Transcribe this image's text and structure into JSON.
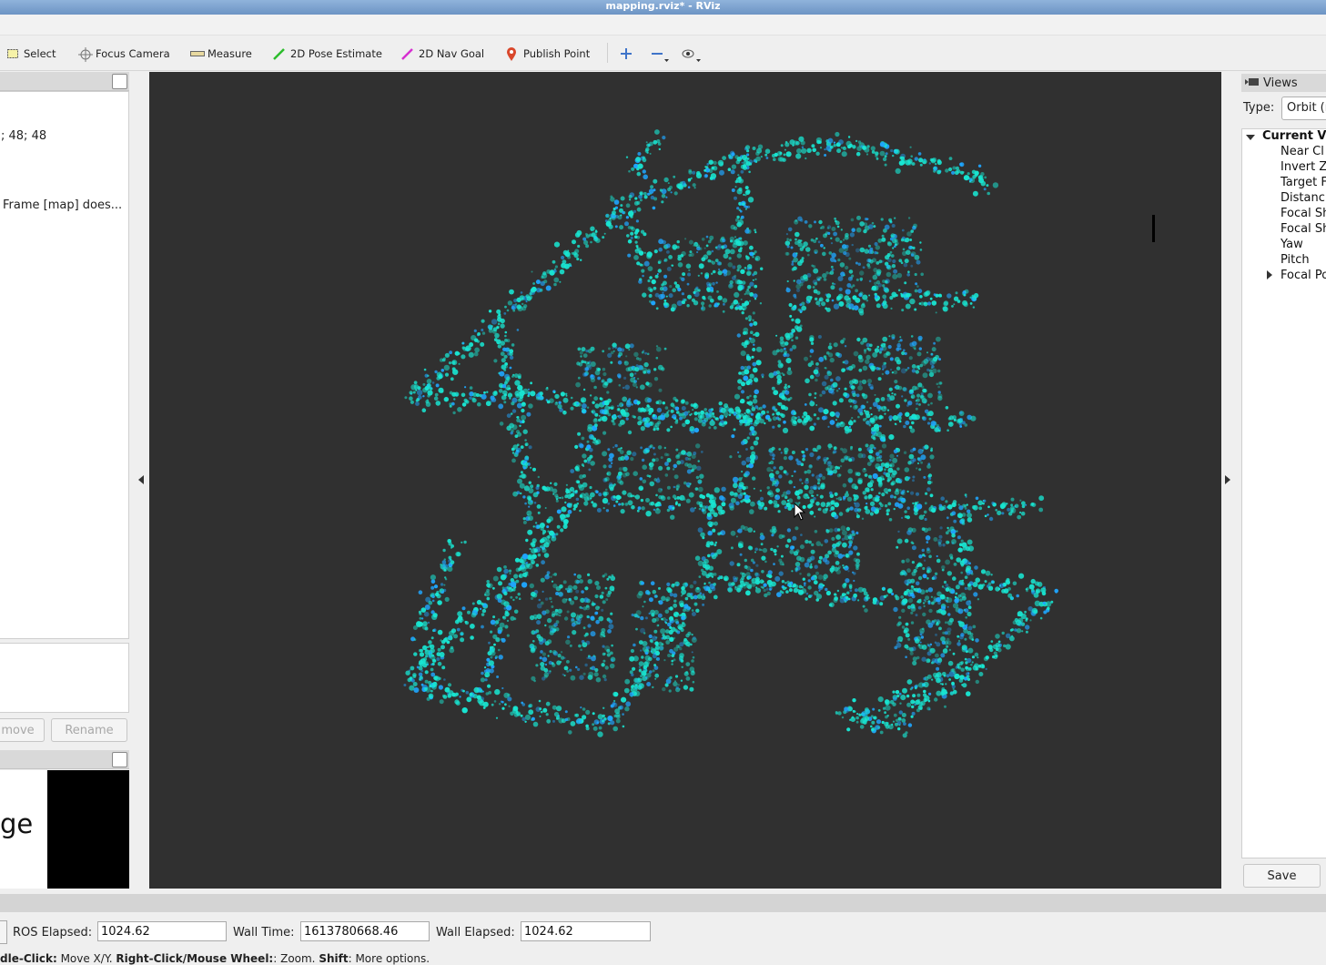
{
  "window": {
    "title": "mapping.rviz* - RViz"
  },
  "toolbar": {
    "select": "Select",
    "focus_camera": "Focus Camera",
    "measure": "Measure",
    "pose_estimate": "2D Pose Estimate",
    "nav_goal": "2D Nav Goal",
    "publish_point": "Publish Point"
  },
  "left_panel": {
    "row1": "; 48; 48",
    "row2": "Frame [map] does...",
    "remove_button": "move",
    "rename_button": "Rename",
    "image_text": "ge"
  },
  "views_panel": {
    "title": "Views",
    "type_label": "Type:",
    "type_value": "Orbit (r",
    "tree": {
      "root": "Current V",
      "items": [
        "Near Cl",
        "Invert Z",
        "Target F",
        "Distanc",
        "Focal Sh",
        "Focal Sh",
        "Yaw",
        "Pitch",
        "Focal Po"
      ]
    },
    "save_button": "Save"
  },
  "time_panel": {
    "ros_elapsed_label": "ROS Elapsed:",
    "ros_elapsed_value": "1024.62",
    "wall_time_label": "Wall Time:",
    "wall_time_value": "1613780668.46",
    "wall_elapsed_label": "Wall Elapsed:",
    "wall_elapsed_value": "1024.62"
  },
  "hint": {
    "k1": "dle-Click:",
    "t1": " Move X/Y. ",
    "k2": "Right-Click/Mouse Wheel:",
    "t2": ": Zoom. ",
    "k3": "Shift",
    "t3": ": More options."
  },
  "colors": {
    "viewport_bg": "#303030",
    "map_cyan": "#18e6d2",
    "map_blue": "#1fa6ff"
  }
}
